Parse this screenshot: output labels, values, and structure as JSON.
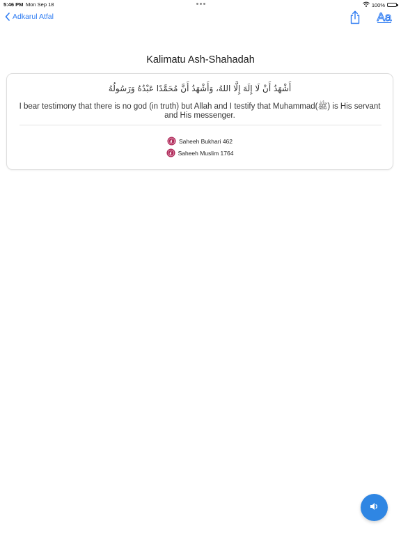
{
  "status_bar": {
    "time": "5:46 PM",
    "date": "Mon Sep 18",
    "battery": "100%",
    "icons": [
      "wifi-icon",
      "battery-icon"
    ]
  },
  "nav": {
    "back_label": "Adkarul Atfal",
    "back_icon": "chevron-left-icon",
    "actions": [
      "share-icon",
      "font-size-icon"
    ],
    "font_icon_text": "Aa",
    "accent_color": "#2d7bf2"
  },
  "page_title": "Kalimatu Ash-Shahadah",
  "card": {
    "arabic": "أَشْهَدُ أَنْ لَا إِلَهَ إِلَّا اللهُ، وَأَشْهَدُ أَنَّ مُحَمَّدًا عَبْدُهُ وَرَسُولُهُ",
    "translation": "I bear testimony that there is no god (in truth) but Allah and I testify that Muhammad(ﷺ) is His servant and His messenger.",
    "references": [
      {
        "label": "Saheeh Bukhari 462",
        "icon": "hadith-book-icon"
      },
      {
        "label": "Saheeh Muslim 1764",
        "icon": "hadith-book-icon"
      }
    ],
    "reference_icon_color": "#b02a5a"
  },
  "audio_button": {
    "icon": "speaker-icon",
    "color": "#2f86e3"
  }
}
